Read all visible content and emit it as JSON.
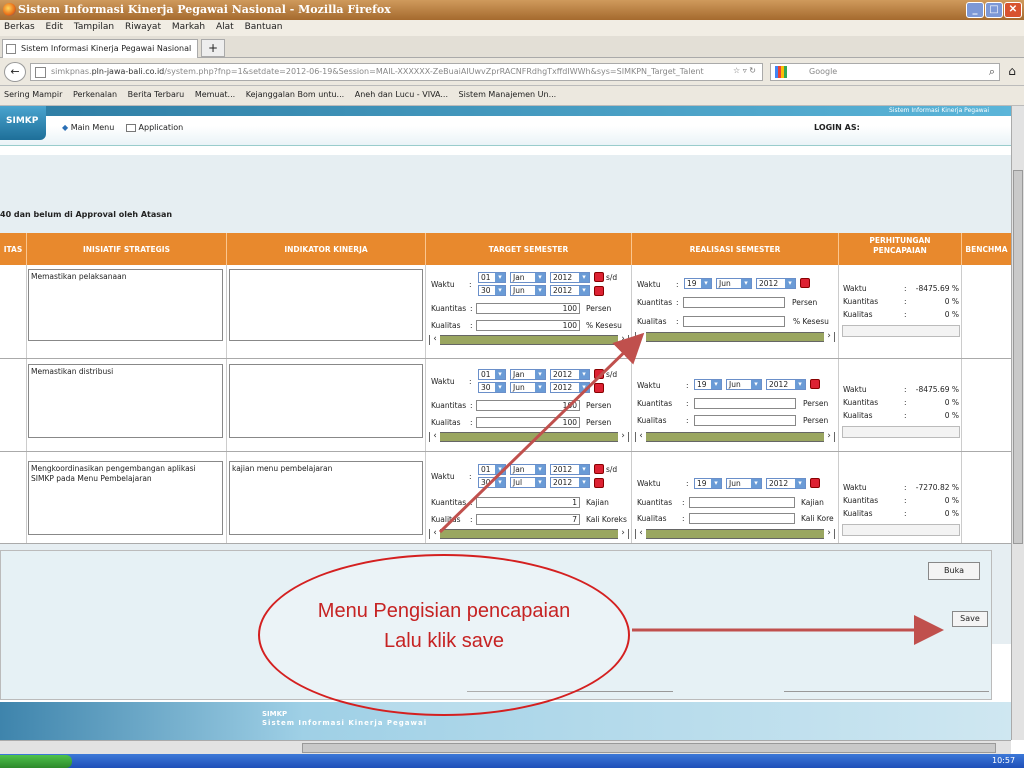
{
  "window": {
    "title": "Sistem Informasi Kinerja Pegawai Nasional - Mozilla Firefox",
    "min": "_",
    "max": "□",
    "close": "✕"
  },
  "menubar": [
    "Berkas",
    "Edit",
    "Tampilan",
    "Riwayat",
    "Markah",
    "Alat",
    "Bantuan"
  ],
  "tab": {
    "label": "Sistem Informasi Kinerja Pegawai Nasional",
    "new_tab": "+"
  },
  "nav": {
    "back": "←",
    "url_prefix": "simkpnas.",
    "url_domain": "pln-jawa-bali.co.id",
    "url_path": "/system.php?fnp=1&setdate=2012-06-19&Session=MAIL-XXXXXX-ZeBuaiAIUwvZprRACNFRdhgTxffdIWWh&sys=SIMKPN_Target_Talent",
    "search_placeholder": "Google",
    "home": "⌂"
  },
  "bookmarks": [
    "Sering Mampir",
    "Perkenalan",
    "Berita Terbaru",
    "Memuat...",
    "Kejanggalan Bom untu...",
    "Aneh dan Lucu - VIVA...",
    "Sistem Manajemen Un..."
  ],
  "app": {
    "header_strip": "Sistem Informasi Kinerja Pegawai",
    "logo": "SIMKP",
    "main_menu": "Main Menu",
    "application": "Application",
    "login_as": "LOGIN AS:",
    "notice": "40 dan belum di Approval oleh Atasan",
    "footer_logo": "SIMKP",
    "footer_sub": "Sistem Informasi Kinerja Pegawai"
  },
  "table": {
    "headers": [
      "ITAS",
      "INISIATIF STRATEGIS",
      "INDIKATOR KINERJA",
      "TARGET SEMESTER",
      "REALISASI SEMESTER",
      "PERHITUNGAN PENCAPAIAN",
      "BENCHMA"
    ],
    "rows": [
      {
        "inisiatif": "Memastikan pelaksanaan",
        "indikator": "",
        "target": {
          "d1": "01",
          "m1": "Jan",
          "y1": "2012",
          "sd": "s/d",
          "d2": "30",
          "m2": "Jun",
          "y2": "2012",
          "kuantitas": "100",
          "kuantitas_unit": "Persen",
          "kualitas": "100",
          "kualitas_unit": "% Kesesu"
        },
        "realisasi": {
          "d": "19",
          "m": "Jun",
          "y": "2012",
          "kuantitas_unit": "Persen",
          "kualitas_unit": "% Kesesu"
        },
        "pencapaian": {
          "waktu": "-8475.69 %",
          "kuantitas": "0 %",
          "kualitas": "0 %"
        }
      },
      {
        "inisiatif": "Memastikan distribusi",
        "indikator": "",
        "target": {
          "d1": "01",
          "m1": "Jan",
          "y1": "2012",
          "sd": "s/d",
          "d2": "30",
          "m2": "Jun",
          "y2": "2012",
          "kuantitas": "100",
          "kuantitas_unit": "Persen",
          "kualitas": "100",
          "kualitas_unit": "Persen"
        },
        "realisasi": {
          "d": "19",
          "m": "Jun",
          "y": "2012",
          "kuantitas_unit": "Persen",
          "kualitas_unit": "Persen"
        },
        "pencapaian": {
          "waktu": "-8475.69 %",
          "kuantitas": "0 %",
          "kualitas": "0 %"
        }
      },
      {
        "inisiatif": "Mengkoordinasikan pengembangan aplikasi SIMKP pada Menu Pembelajaran",
        "indikator": "kajian menu pembelajaran",
        "target": {
          "d1": "01",
          "m1": "Jan",
          "y1": "2012",
          "sd": "s/d",
          "d2": "30",
          "m2": "Jul",
          "y2": "2012",
          "kuantitas": "1",
          "kuantitas_unit": "Kajian",
          "kualitas": "7",
          "kualitas_unit": "Kali Koreks"
        },
        "realisasi": {
          "d": "19",
          "m": "Jun",
          "y": "2012",
          "kuantitas_unit": "Kajian",
          "kualitas_unit": "Kali Kore"
        },
        "pencapaian": {
          "waktu": "-7270.82 %",
          "kuantitas": "0 %",
          "kualitas": "0 %"
        }
      }
    ],
    "labels": {
      "waktu": "Waktu",
      "kuantitas": "Kuantitas",
      "kualitas": "Kualitas",
      "colon": ":"
    }
  },
  "buttons": {
    "buka": "Buka",
    "save": "Save"
  },
  "callout": {
    "line1": "Menu Pengisian pencapaian",
    "line2": "Lalu  klik save"
  },
  "taskbar": {
    "clock": "10:57"
  }
}
